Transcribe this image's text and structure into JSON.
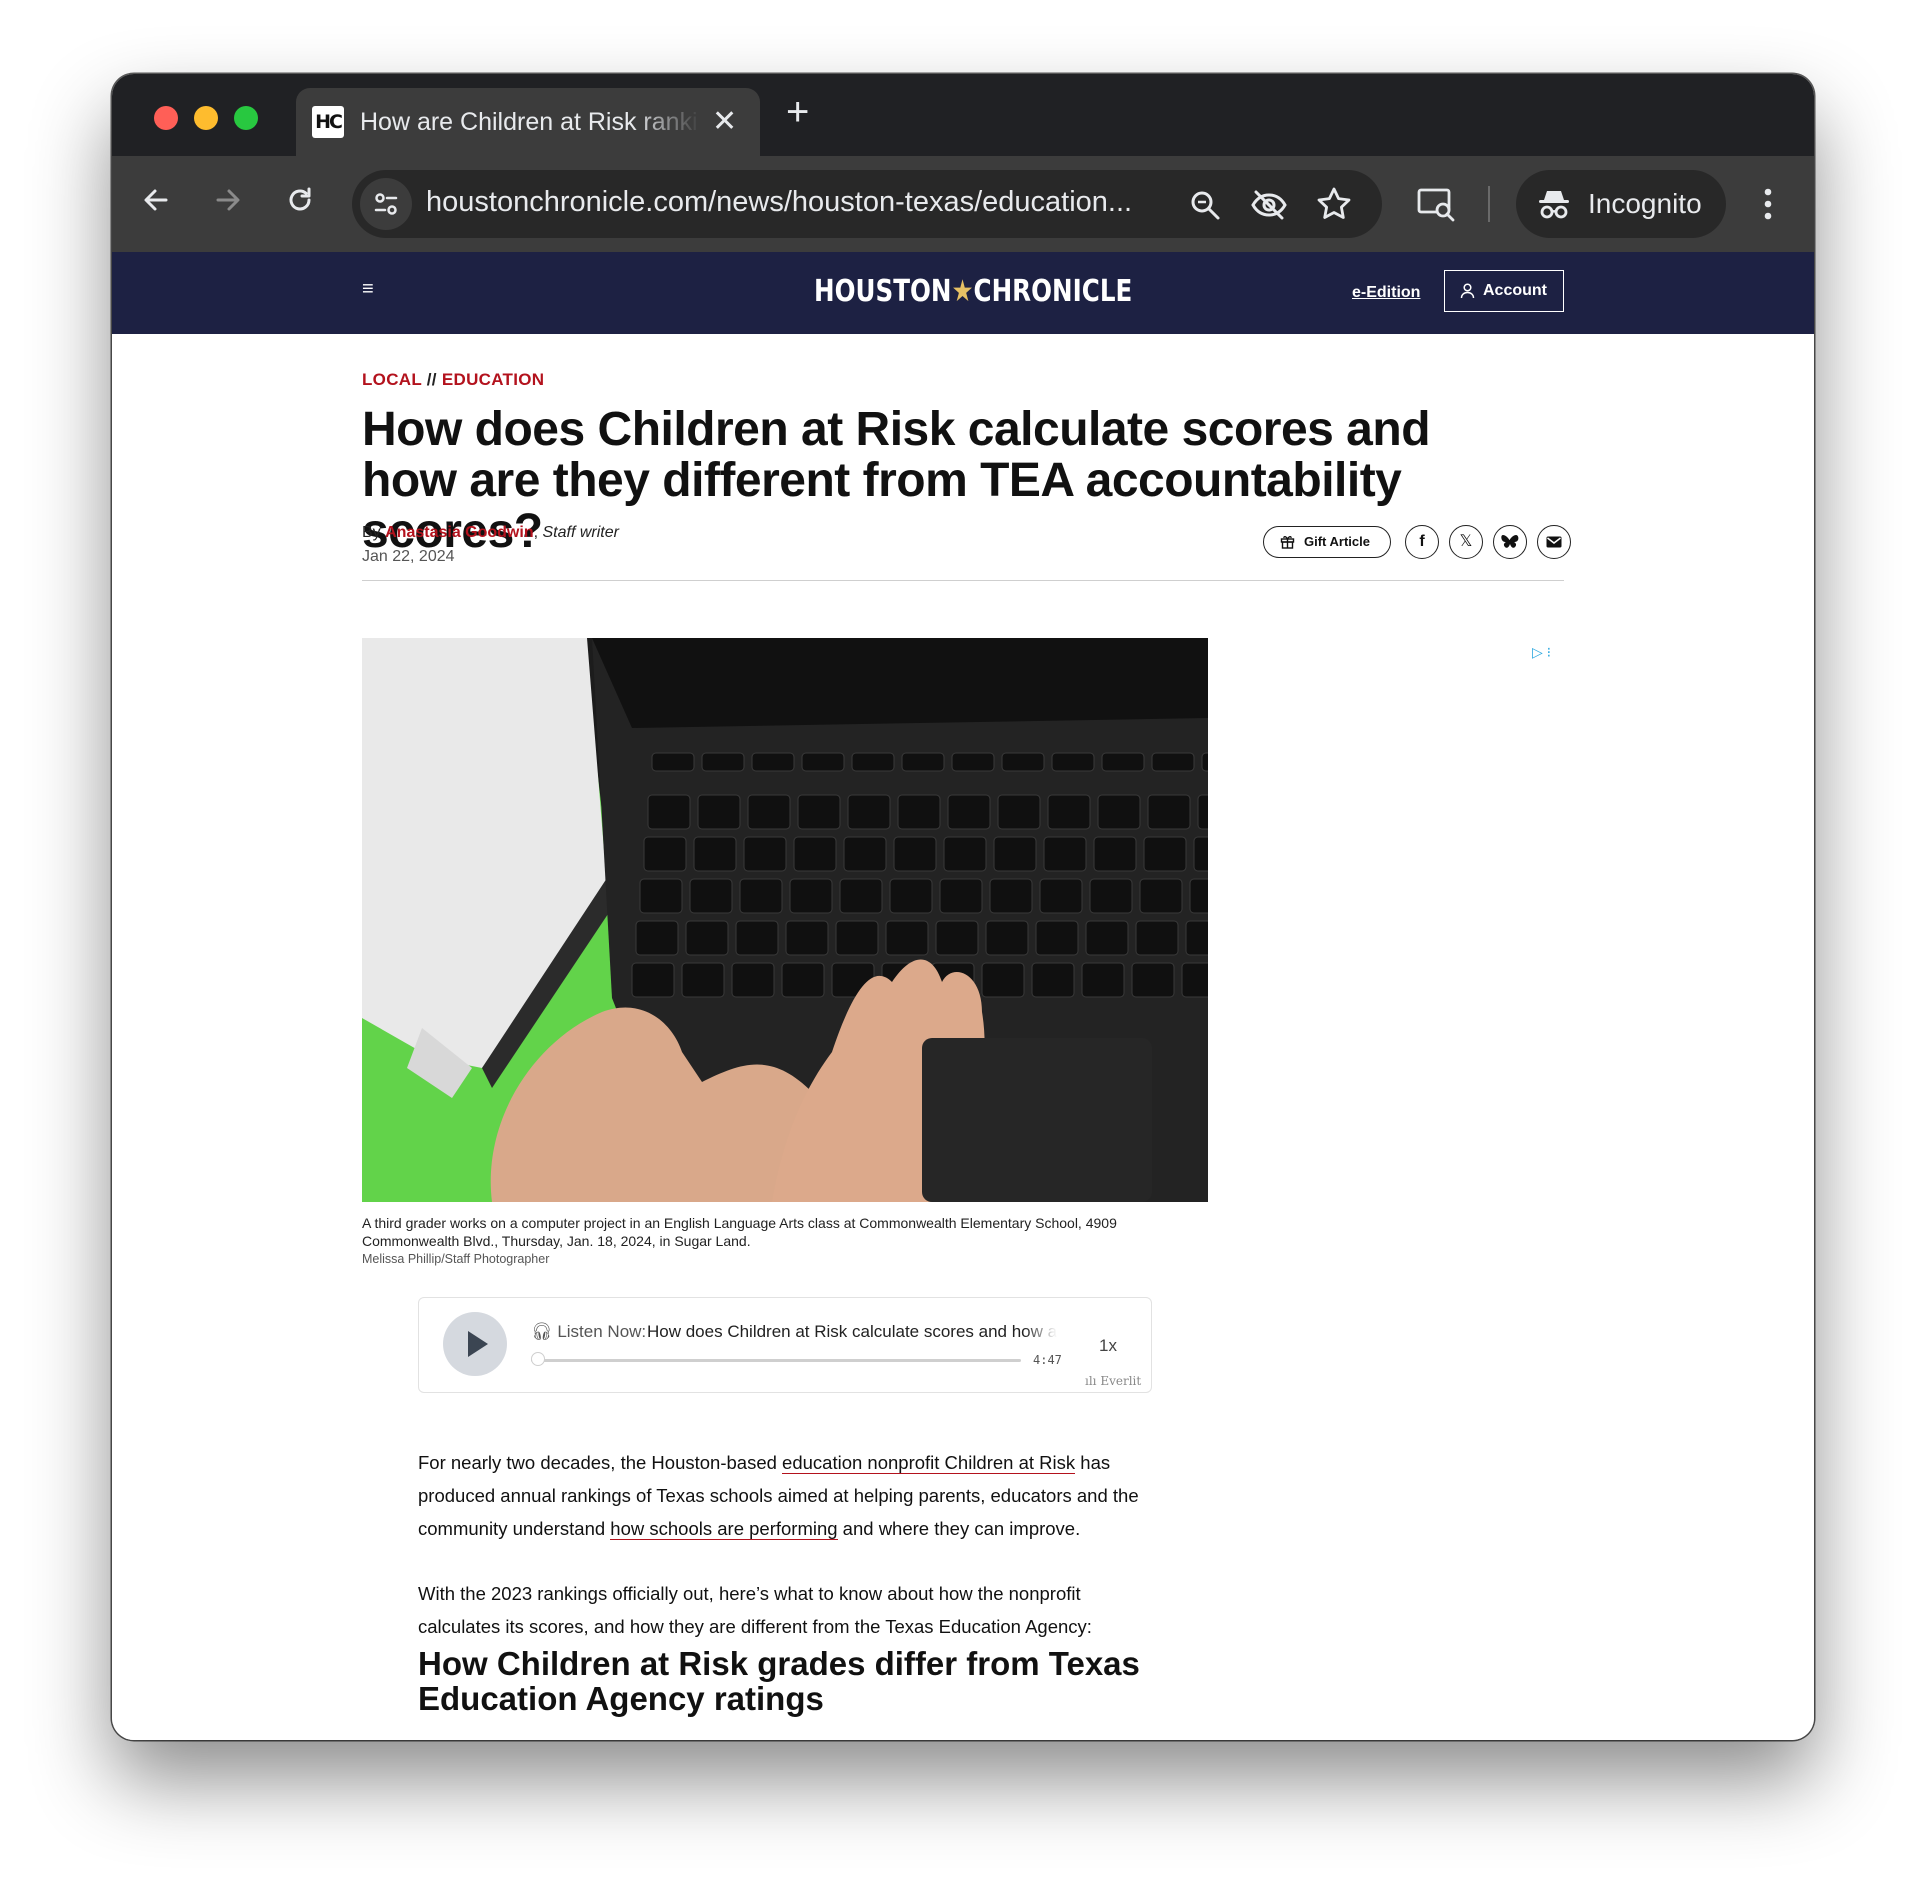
{
  "browser": {
    "tab_title": "How are Children at Risk rankings",
    "favicon_text": "HC",
    "url": "houstonchronicle.com/news/houston-texas/education...",
    "profile_label": "Incognito"
  },
  "site": {
    "logo_left": "HOUSTON",
    "logo_star": "★",
    "logo_right": "CHRONICLE",
    "eedition_label": "e-Edition",
    "account_label": "Account"
  },
  "article": {
    "kicker_local": "LOCAL",
    "kicker_sep": "//",
    "kicker_section": "EDUCATION",
    "headline": "How does Children at Risk calculate scores and how are they different from TEA accountability scores?",
    "by_prefix": "By",
    "author": "Anastasia Goodwin",
    "role": "Staff writer",
    "date": "Jan 22, 2024",
    "gift_label": "Gift Article",
    "caption": "A third grader works on a computer project in an English Language Arts class at Commonwealth Elementary School, 4909 Commonwealth Blvd., Thursday, Jan. 18, 2024, in Sugar Land.",
    "photo_credit": "Melissa Phillip/Staff Photographer"
  },
  "player": {
    "listen_label": "Listen Now:",
    "track_title": "How does Children at Risk calculate scores and how are they different from TEA accountability scores?",
    "duration": "4:47",
    "speed": "1x",
    "brand": "Everlit",
    "progress": 0
  },
  "body": {
    "p1_a": "For nearly two decades, the Houston-based ",
    "p1_link1": "education nonprofit Children at Risk",
    "p1_b": " has produced annual rankings of Texas schools aimed at helping parents, educators and the community understand ",
    "p1_link2": "how schools are performing",
    "p1_c": " and where they can improve.",
    "p2": "With the 2023 rankings officially out, here’s what to know about how the nonprofit calculates its scores, and how they are different from the Texas Education Agency:",
    "subhead": "How Children at Risk grades differ from Texas Education Agency ratings"
  },
  "icons": {
    "back": "arrow-left-icon",
    "forward": "arrow-right-icon",
    "reload": "reload-icon",
    "site_info": "tune-icon",
    "zoom": "zoom-icon",
    "eye_off": "eye-off-icon",
    "star": "star-icon",
    "lens": "search-page-icon",
    "incognito": "incognito-icon",
    "menu": "kebab-icon",
    "facebook": "facebook-icon",
    "x": "x-icon",
    "bluesky": "bluesky-icon",
    "email": "email-icon"
  },
  "colors": {
    "brand_navy": "#1d2143",
    "accent_red": "#b3121d",
    "logo_star": "#e7c165"
  }
}
